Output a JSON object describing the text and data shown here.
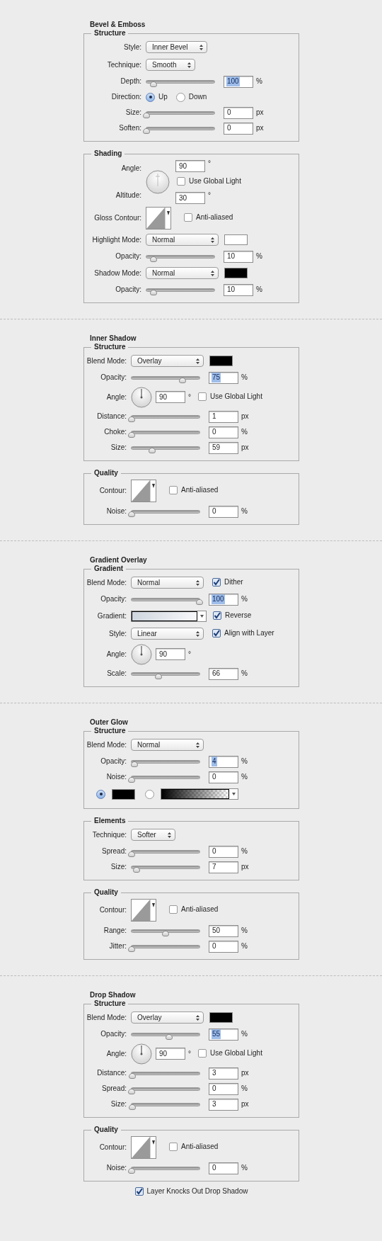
{
  "sections": [
    {
      "title": "Bevel & Emboss",
      "groups": [
        {
          "title": "Structure",
          "rows": [
            {
              "kind": "select",
              "label": "Style:",
              "value": "Inner Bevel"
            },
            {
              "kind": "select",
              "label": "Technique:",
              "value": "Smooth"
            },
            {
              "kind": "slider",
              "label": "Depth:",
              "level": 0.1,
              "value": "100",
              "unit": "%",
              "value_selected": true
            },
            {
              "kind": "radio",
              "label": "Direction:",
              "options": [
                {
                  "label": "Up",
                  "selected": true
                },
                {
                  "label": "Down",
                  "selected": false
                }
              ]
            },
            {
              "kind": "slider",
              "label": "Size:",
              "level": 0,
              "value": "0",
              "unit": "px",
              "value_selected": false
            },
            {
              "kind": "slider",
              "label": "Soften:",
              "level": 0,
              "value": "0",
              "unit": "px",
              "value_selected": false
            }
          ]
        },
        {
          "title": "Shading",
          "rows": [
            {
              "kind": "light",
              "angle": {
                "label": "Angle:",
                "value": "90",
                "unit": "°"
              },
              "global_light": {
                "label": "Use Global Light",
                "checked": false
              },
              "altitude": {
                "label": "Altitude:",
                "value": "30",
                "unit": "°"
              }
            },
            {
              "kind": "contour",
              "label": "Gloss Contour:",
              "checkbox": {
                "label": "Anti-aliased",
                "checked": false
              }
            },
            {
              "kind": "mode_select",
              "label": "Highlight Mode:",
              "value": "Normal",
              "color": "#ffffff"
            },
            {
              "kind": "slider",
              "label": "Opacity:",
              "level": 0.1,
              "value": "10",
              "unit": "%",
              "value_selected": false
            },
            {
              "kind": "mode_select",
              "label": "Shadow Mode:",
              "value": "Normal",
              "color": "#000000"
            },
            {
              "kind": "slider",
              "label": "Opacity:",
              "level": 0.1,
              "value": "10",
              "unit": "%",
              "value_selected": false
            }
          ]
        }
      ]
    },
    {
      "title": "Inner Shadow",
      "groups": [
        {
          "title": "Structure",
          "rows": [
            {
              "kind": "mode_select",
              "label": "Blend Mode:",
              "value": "Overlay",
              "color": "#000000"
            },
            {
              "kind": "slider",
              "label": "Opacity:",
              "level": 0.75,
              "value": "75",
              "unit": "%",
              "value_selected": true
            },
            {
              "kind": "angle",
              "label": "Angle:",
              "value": "90",
              "unit": "°",
              "checkbox": {
                "label": "Use Global Light",
                "checked": false
              }
            },
            {
              "kind": "slider",
              "label": "Distance:",
              "level": 0,
              "value": "1",
              "unit": "px",
              "value_selected": false
            },
            {
              "kind": "slider",
              "label": "Choke:",
              "level": 0,
              "value": "0",
              "unit": "%",
              "value_selected": false
            },
            {
              "kind": "slider",
              "label": "Size:",
              "level": 0.3,
              "value": "59",
              "unit": "px",
              "value_selected": false
            }
          ]
        },
        {
          "title": "Quality",
          "rows": [
            {
              "kind": "contour",
              "label": "Contour:",
              "checkbox": {
                "label": "Anti-aliased",
                "checked": false
              }
            },
            {
              "kind": "slider",
              "label": "Noise:",
              "level": 0,
              "value": "0",
              "unit": "%",
              "value_selected": false
            }
          ]
        }
      ]
    },
    {
      "title": "Gradient Overlay",
      "groups": [
        {
          "title": "Gradient",
          "rows": [
            {
              "kind": "mode_select",
              "label": "Blend Mode:",
              "value": "Normal",
              "checkbox": {
                "label": "Dither",
                "checked": true
              }
            },
            {
              "kind": "slider",
              "label": "Opacity:",
              "level": 1,
              "value": "100",
              "unit": "%",
              "value_selected": true
            },
            {
              "kind": "gradient",
              "label": "Gradient:",
              "checkbox": {
                "label": "Reverse",
                "checked": true
              }
            },
            {
              "kind": "mode_select",
              "label": "Style:",
              "value": "Linear",
              "checkbox": {
                "label": "Align with Layer",
                "checked": true
              }
            },
            {
              "kind": "angle",
              "label": "Angle:",
              "value": "90",
              "unit": "°"
            },
            {
              "kind": "slider",
              "label": "Scale:",
              "level": 0.4,
              "value": "66",
              "unit": "%",
              "value_selected": false
            }
          ]
        }
      ]
    },
    {
      "title": "Outer Glow",
      "groups": [
        {
          "title": "Structure",
          "rows": [
            {
              "kind": "mode_select",
              "label": "Blend Mode:",
              "value": "Normal"
            },
            {
              "kind": "slider",
              "label": "Opacity:",
              "level": 0.04,
              "value": "4",
              "unit": "%",
              "value_selected": true
            },
            {
              "kind": "slider",
              "label": "Noise:",
              "level": 0,
              "value": "0",
              "unit": "%",
              "value_selected": false
            },
            {
              "kind": "source",
              "options": [
                {
                  "kind": "color",
                  "color": "#000000",
                  "selected": true
                },
                {
                  "kind": "gradient",
                  "selected": false
                }
              ]
            }
          ]
        },
        {
          "title": "Elements",
          "rows": [
            {
              "kind": "select",
              "label": "Technique:",
              "value": "Softer"
            },
            {
              "kind": "slider",
              "label": "Spread:",
              "level": 0,
              "value": "0",
              "unit": "%",
              "value_selected": false
            },
            {
              "kind": "slider",
              "label": "Size:",
              "level": 0.07,
              "value": "7",
              "unit": "px",
              "value_selected": false
            }
          ]
        },
        {
          "title": "Quality",
          "rows": [
            {
              "kind": "contour",
              "label": "Contour:",
              "checkbox": {
                "label": "Anti-aliased",
                "checked": false
              }
            },
            {
              "kind": "slider",
              "label": "Range:",
              "level": 0.5,
              "value": "50",
              "unit": "%",
              "value_selected": false
            },
            {
              "kind": "slider",
              "label": "Jitter:",
              "level": 0,
              "value": "0",
              "unit": "%",
              "value_selected": false
            }
          ]
        }
      ]
    },
    {
      "title": "Drop Shadow",
      "groups": [
        {
          "title": "Structure",
          "rows": [
            {
              "kind": "mode_select",
              "label": "Blend Mode:",
              "value": "Overlay",
              "color": "#000000"
            },
            {
              "kind": "slider",
              "label": "Opacity:",
              "level": 0.55,
              "value": "55",
              "unit": "%",
              "value_selected": true
            },
            {
              "kind": "angle",
              "label": "Angle:",
              "value": "90",
              "unit": "°",
              "checkbox": {
                "label": "Use Global Light",
                "checked": false
              }
            },
            {
              "kind": "slider",
              "label": "Distance:",
              "level": 0.01,
              "value": "3",
              "unit": "px",
              "value_selected": false
            },
            {
              "kind": "slider",
              "label": "Spread:",
              "level": 0,
              "value": "0",
              "unit": "%",
              "value_selected": false
            },
            {
              "kind": "slider",
              "label": "Size:",
              "level": 0.01,
              "value": "3",
              "unit": "px",
              "value_selected": false
            }
          ]
        },
        {
          "title": "Quality",
          "rows": [
            {
              "kind": "contour",
              "label": "Contour:",
              "checkbox": {
                "label": "Anti-aliased",
                "checked": false
              }
            },
            {
              "kind": "slider",
              "label": "Noise:",
              "level": 0,
              "value": "0",
              "unit": "%",
              "value_selected": false
            }
          ]
        }
      ],
      "footer_checkbox": {
        "label": "Layer Knocks Out Drop Shadow",
        "checked": true
      }
    }
  ]
}
